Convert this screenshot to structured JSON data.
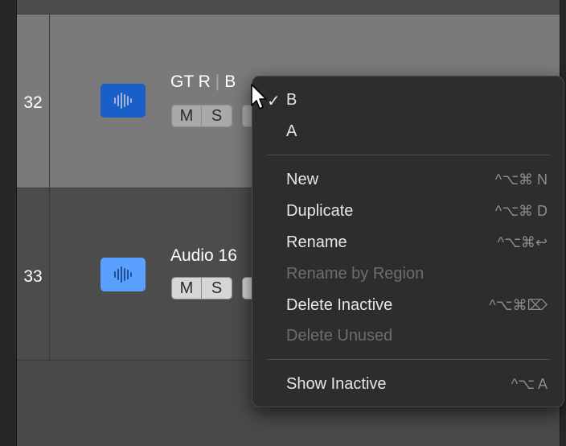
{
  "tracks": [
    {
      "number": "32",
      "name": "GT R",
      "alt_label": "B",
      "icon": "waveform-icon",
      "mute_label": "M",
      "solo_label": "S"
    },
    {
      "number": "33",
      "name": "Audio 16",
      "icon": "waveform-icon",
      "mute_label": "M",
      "solo_label": "S"
    }
  ],
  "menu": {
    "items": [
      {
        "label": "B",
        "checked": true,
        "check": "✓"
      },
      {
        "label": "A",
        "checked": false
      },
      {
        "label": "New",
        "shortcut": "^⌥⌘ N"
      },
      {
        "label": "Duplicate",
        "shortcut": "^⌥⌘ D"
      },
      {
        "label": "Rename",
        "shortcut": "^⌥⌘↩"
      },
      {
        "label": "Rename by Region",
        "disabled": true
      },
      {
        "label": "Delete Inactive",
        "shortcut": "^⌥⌘⌦"
      },
      {
        "label": "Delete Unused",
        "disabled": true
      },
      {
        "label": "Show Inactive",
        "shortcut": "^⌥ A"
      }
    ]
  },
  "colors": {
    "track32_icon": "#1a5fc8",
    "track33_icon": "#5aa0ff",
    "menu_bg": "#2d2d2d",
    "selected_track_bg": "#7a7a7a"
  }
}
